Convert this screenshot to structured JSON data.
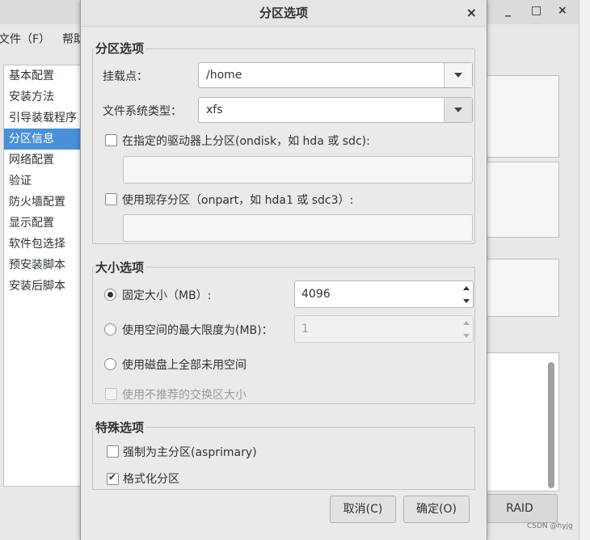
{
  "background": {
    "menu": [
      "文件（F）",
      "帮助"
    ],
    "window_controls": [
      "_",
      "□",
      "×"
    ],
    "sidebar": {
      "items": [
        {
          "label": "基本配置"
        },
        {
          "label": "安装方法"
        },
        {
          "label": "引导装载程序"
        },
        {
          "label": "分区信息",
          "selected": true
        },
        {
          "label": "网络配置"
        },
        {
          "label": "验证"
        },
        {
          "label": "防火墙配置"
        },
        {
          "label": "显示配置"
        },
        {
          "label": "软件包选择"
        },
        {
          "label": "预安装脚本"
        },
        {
          "label": "安装后脚本"
        }
      ]
    },
    "raid_button": "RAID",
    "watermark": "CSDN @hyjg"
  },
  "dialog": {
    "title": "分区选项",
    "close_icon": "×",
    "partition_section": {
      "title": "分区选项",
      "mount_point_label": "挂载点：",
      "mount_point_value": "/home",
      "fs_type_label": "文件系统类型：",
      "fs_type_value": "xfs",
      "ondisk_label": "在指定的驱动器上分区(ondisk，如 hda 或 sdc):",
      "ondisk_checked": false,
      "ondisk_value": "",
      "onpart_label": "使用现存分区（onpart，如 hda1 或 sdc3）:",
      "onpart_checked": false,
      "onpart_value": ""
    },
    "size_section": {
      "title": "大小选项",
      "fixed_label": "固定大小（MB）:",
      "fixed_value": "4096",
      "max_label": "使用空间的最大限度为(MB)：",
      "max_value": "1",
      "fill_label": "使用磁盘上全部未用空间",
      "swap_label": "使用不推荐的交换区大小",
      "selected": "fixed"
    },
    "special_section": {
      "title": "特殊选项",
      "asprimary_label": "强制为主分区(asprimary)",
      "asprimary_checked": false,
      "format_label": "格式化分区",
      "format_checked": true
    },
    "cancel_label": "取消(C)",
    "ok_label": "确定(O)"
  }
}
